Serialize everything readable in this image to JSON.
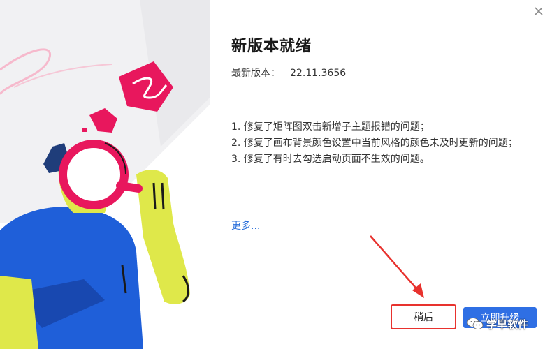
{
  "dialog": {
    "title": "新版本就绪",
    "version_label": "最新版本：",
    "version_value": "22.11.3656",
    "notes": [
      "1. 修复了矩阵图双击新增子主题报错的问题；",
      "2. 修复了画布背景颜色设置中当前风格的颜色未及时更新的问题；",
      "3. 修复了有时去勾选启动页面不生效的问题。"
    ],
    "more_link": "更多...",
    "later_button": "稍后",
    "upgrade_button": "立即升级"
  },
  "watermark": {
    "text": "学早软件"
  },
  "colors": {
    "accent_blue": "#2f6fe4",
    "highlight_red": "#e8322e",
    "illustration_magenta": "#e8175d",
    "illustration_blue": "#1f5fd9",
    "illustration_yellow": "#dfe84a"
  },
  "icons": {
    "close": "close-icon",
    "watermark": "wechat-icon"
  }
}
